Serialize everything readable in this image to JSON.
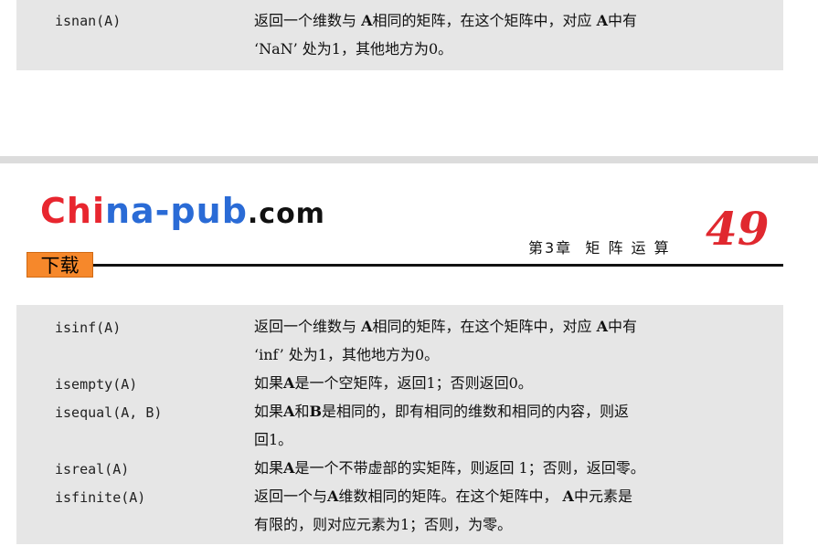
{
  "top_box": {
    "rows": [
      {
        "fn": "isnan(A)",
        "desc": [
          [
            {
              "t": "返回一个维数与 "
            },
            {
              "t": "A",
              "b": true
            },
            {
              "t": "相同的矩阵，在这个矩阵中，对应 "
            },
            {
              "t": "A",
              "b": true
            },
            {
              "t": "中有"
            }
          ],
          [
            {
              "t": "‘NaN’ 处为1，其他地方为0。"
            }
          ]
        ]
      }
    ]
  },
  "header": {
    "logo_parts": [
      "Chi",
      "na-pub",
      ".com"
    ],
    "badge": "下载",
    "chapter": "第3章  矩 阵 运 算",
    "page_number": "49"
  },
  "bottom_box": {
    "rows": [
      {
        "fn": "isinf(A)",
        "desc": [
          [
            {
              "t": "返回一个维数与 "
            },
            {
              "t": "A",
              "b": true
            },
            {
              "t": "相同的矩阵，在这个矩阵中，对应 "
            },
            {
              "t": "A",
              "b": true
            },
            {
              "t": "中有"
            }
          ],
          [
            {
              "t": "‘inf’ 处为1，其他地方为0。"
            }
          ]
        ]
      },
      {
        "fn": "isempty(A)",
        "desc": [
          [
            {
              "t": "如果"
            },
            {
              "t": "A",
              "b": true
            },
            {
              "t": "是一个空矩阵，返回1；否则返回0。"
            }
          ]
        ]
      },
      {
        "fn": "isequal(A, B)",
        "desc": [
          [
            {
              "t": "如果"
            },
            {
              "t": "A",
              "b": true
            },
            {
              "t": "和"
            },
            {
              "t": "B",
              "b": true
            },
            {
              "t": "是相同的，即有相同的维数和相同的内容，则返"
            }
          ],
          [
            {
              "t": "回1。"
            }
          ]
        ]
      },
      {
        "fn": "isreal(A)",
        "desc": [
          [
            {
              "t": "如果"
            },
            {
              "t": "A",
              "b": true
            },
            {
              "t": "是一个不带虚部的实矩阵，则返回 1；否则，返回零。"
            }
          ]
        ]
      },
      {
        "fn": "isfinite(A)",
        "desc": [
          [
            {
              "t": "返回一个与"
            },
            {
              "t": "A",
              "b": true
            },
            {
              "t": "维数相同的矩阵。在这个矩阵中， "
            },
            {
              "t": "A",
              "b": true
            },
            {
              "t": "中元素是"
            }
          ],
          [
            {
              "t": "有限的，则对应元素为1；否则，为零。"
            }
          ]
        ]
      }
    ]
  }
}
